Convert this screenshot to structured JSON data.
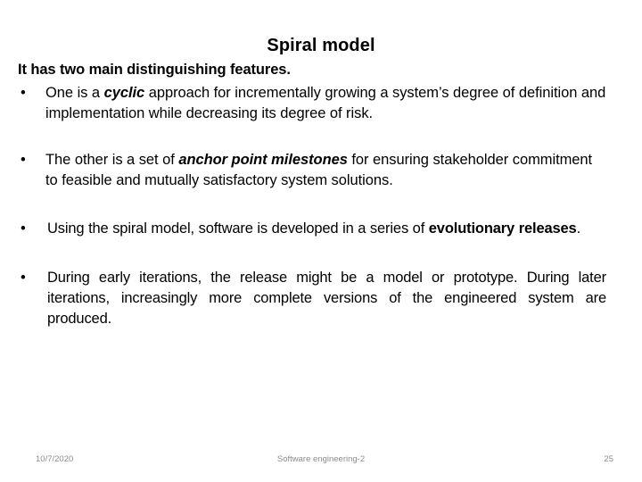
{
  "slide": {
    "title": "Spiral model",
    "lead_line": "It has two main distinguishing features.",
    "bullet_marker": "•",
    "bullets": [
      {
        "id": "bullet-1",
        "align": "left",
        "parts": [
          {
            "text": "One is a ",
            "style": "normal"
          },
          {
            "text": "cyclic",
            "style": "bold-italic"
          },
          {
            "text": " approach for incrementally growing a system’s degree of definition and implementation while decreasing its degree of risk.",
            "style": "normal"
          }
        ],
        "plain": "One is a cyclic approach for incrementally growing a system’s degree of definition and implementation while decreasing its degree of risk."
      },
      {
        "id": "bullet-2",
        "align": "left",
        "parts": [
          {
            "text": "The other is a set of ",
            "style": "normal"
          },
          {
            "text": "anchor point milestones",
            "style": "bold-italic"
          },
          {
            "text": " for ensuring stakeholder commitment to feasible and mutually satisfactory system solutions.",
            "style": "normal"
          }
        ],
        "plain": "The other is a set of anchor point milestones for ensuring stakeholder commitment to feasible and mutually satisfactory system solutions."
      },
      {
        "id": "bullet-3",
        "align": "justify",
        "parts": [
          {
            "text": "Using the spiral model, software is developed in a series of ",
            "style": "normal"
          },
          {
            "text": "evolutionary releases",
            "style": "bold"
          },
          {
            "text": ".",
            "style": "normal"
          }
        ],
        "plain": "Using the spiral model, software is developed in a series of evolutionary releases."
      },
      {
        "id": "bullet-4",
        "align": "justify",
        "parts": [
          {
            "text": "During early iterations, the release might be a model or prototype. During later iterations, increasingly more complete versions of the engineered system are produced.",
            "style": "normal"
          }
        ],
        "plain": "During early iterations, the release might be a model or prototype. During later iterations, increasingly more complete versions of the engineered system are produced."
      }
    ]
  },
  "footer": {
    "date": "10/7/2020",
    "center_text": "Software engineering-2",
    "page_number": "25",
    "color": "#8c8c8c"
  }
}
